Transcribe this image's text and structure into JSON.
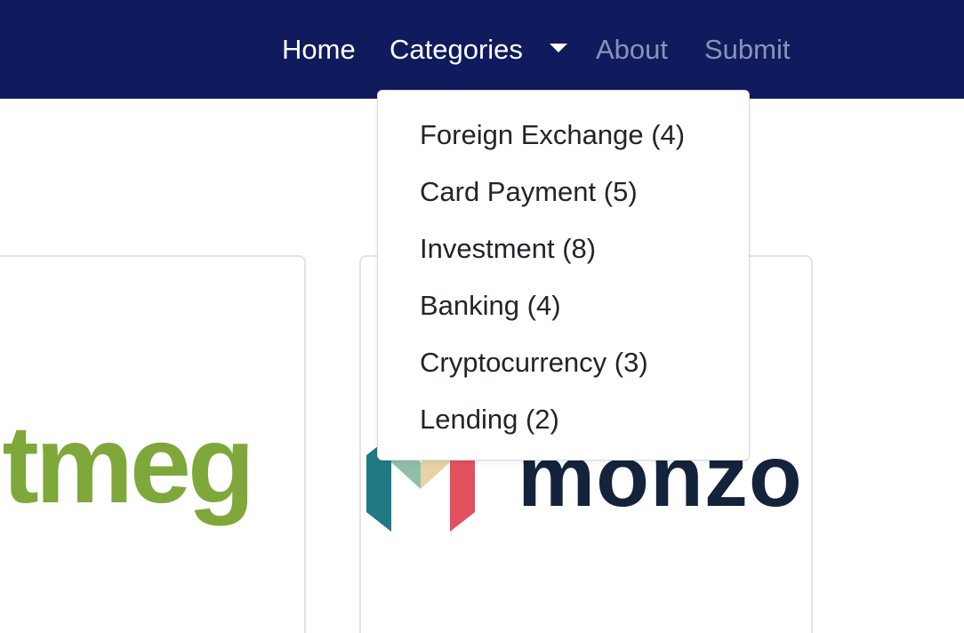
{
  "nav": {
    "home": "Home",
    "categories": "Categories",
    "about": "About",
    "submit": "Submit"
  },
  "dropdown": {
    "items": [
      {
        "label": "Foreign Exchange (4)"
      },
      {
        "label": "Card Payment (5)"
      },
      {
        "label": "Investment (8)"
      },
      {
        "label": "Banking (4)"
      },
      {
        "label": "Cryptocurrency (3)"
      },
      {
        "label": "Lending (2)"
      }
    ]
  },
  "cards": {
    "left_logo": "ıtmeg",
    "right_logo": "monzo"
  },
  "colors": {
    "navbar": "#0f1b5c",
    "nav_active": "#ffffff",
    "nav_muted": "#8b93b6",
    "nutmeg_green": "#7fa83a",
    "monzo_navy": "#14233c",
    "monzo_teal": "#1f7a86",
    "monzo_sage": "#8fbfa8",
    "monzo_sand": "#e7d3a3",
    "monzo_coral": "#e5505f"
  },
  "icons": {
    "categories_caret": "chevron-down-icon",
    "monzo_mark": "monzo-logo-icon"
  }
}
